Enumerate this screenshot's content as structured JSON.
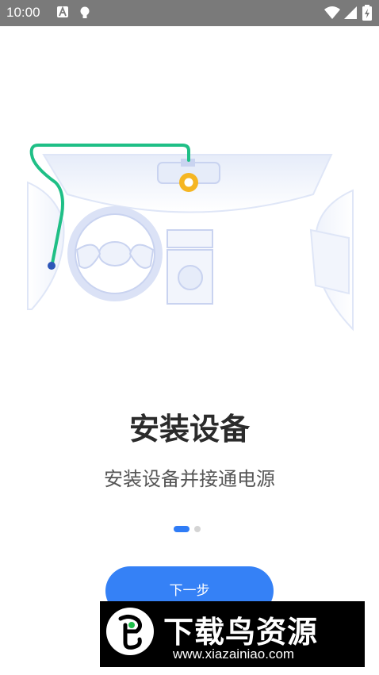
{
  "status_bar": {
    "time": "10:00",
    "icons": [
      "a-badge-icon",
      "lightbulb-icon",
      "wifi-icon",
      "signal-icon",
      "battery-icon"
    ]
  },
  "illustration": {
    "name": "car-dashcam-install-illustration",
    "colors": {
      "cable": "#1fbf86",
      "lens": "#f5b623",
      "outline": "#c9d3f0",
      "fill": "#eef2fb"
    }
  },
  "onboarding": {
    "title": "安装设备",
    "subtitle": "安装设备并接通电源",
    "page_index": 1,
    "page_count": 2,
    "next_button_label": "下一步"
  },
  "watermark": {
    "title": "下载鸟资源",
    "url": "www.xiazainiao.com"
  },
  "colors": {
    "accent": "#3581f6",
    "status_bar": "#7a7a7a"
  }
}
